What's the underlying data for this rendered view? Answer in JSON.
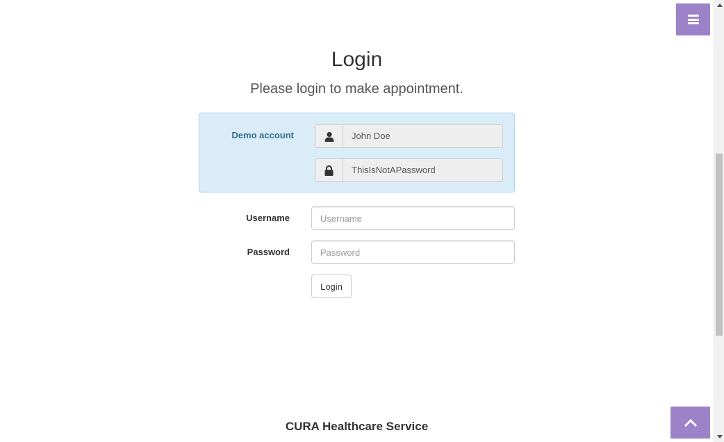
{
  "header": {
    "menu_icon": "hamburger-menu-icon",
    "accent_color": "#9b82c9"
  },
  "login": {
    "title": "Login",
    "subtitle": "Please login to make appointment."
  },
  "demo_account": {
    "label": "Demo account",
    "username": "John Doe",
    "password": "ThisIsNotAPassword",
    "user_icon": "user-icon",
    "lock_icon": "lock-icon",
    "background_color": "#d9ecf8",
    "label_color": "#31708f"
  },
  "form": {
    "username_label": "Username",
    "username_placeholder": "Username",
    "username_value": "",
    "password_label": "Password",
    "password_placeholder": "Password",
    "password_value": "",
    "login_button": "Login"
  },
  "footer": {
    "title": "CURA Healthcare Service"
  },
  "to_top": {
    "icon": "chevron-up-icon"
  }
}
